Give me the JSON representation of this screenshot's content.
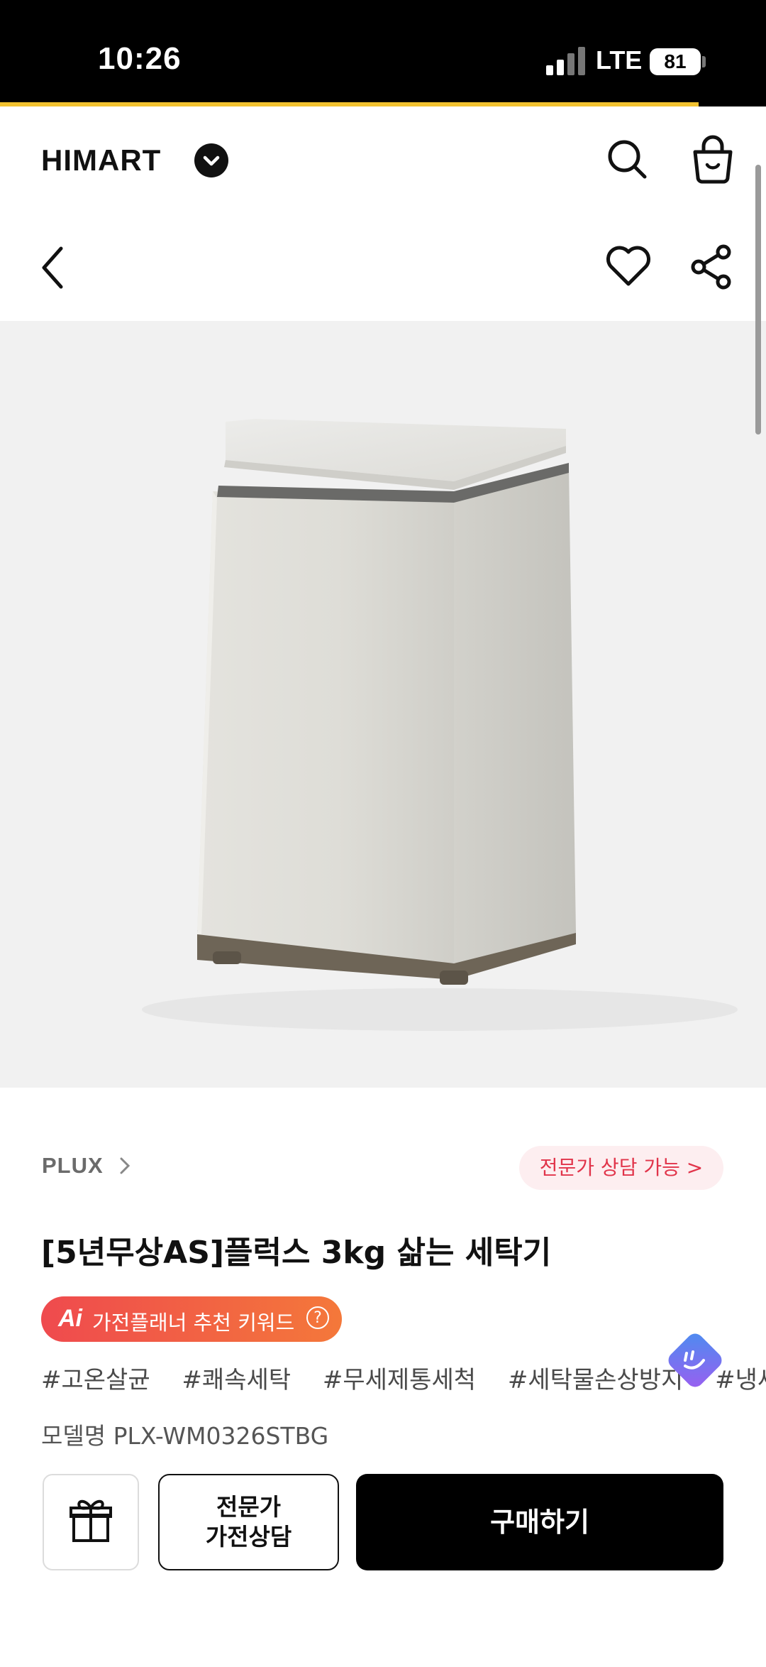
{
  "status_bar": {
    "time": "10:26",
    "network": "LTE",
    "battery": "81"
  },
  "header": {
    "logo": "HIMART"
  },
  "product": {
    "brand": "PLUX",
    "expert_badge": "전문가 상담 가능 >",
    "title": "[5년무상AS]플럭스 3kg 삶는 세탁기",
    "ai_badge_mark": "Ai",
    "ai_badge_text": "가전플래너 추천 키워드",
    "ai_badge_help": "?",
    "tags": [
      "#고온살균",
      "#쾌속세탁",
      "#무세제통세척",
      "#세탁물손상방지",
      "#냉세"
    ],
    "model": "모델명 PLX-WM0326STBG"
  },
  "bottom_bar": {
    "consult_line1": "전문가",
    "consult_line2": "가전상담",
    "buy_label": "구매하기"
  }
}
